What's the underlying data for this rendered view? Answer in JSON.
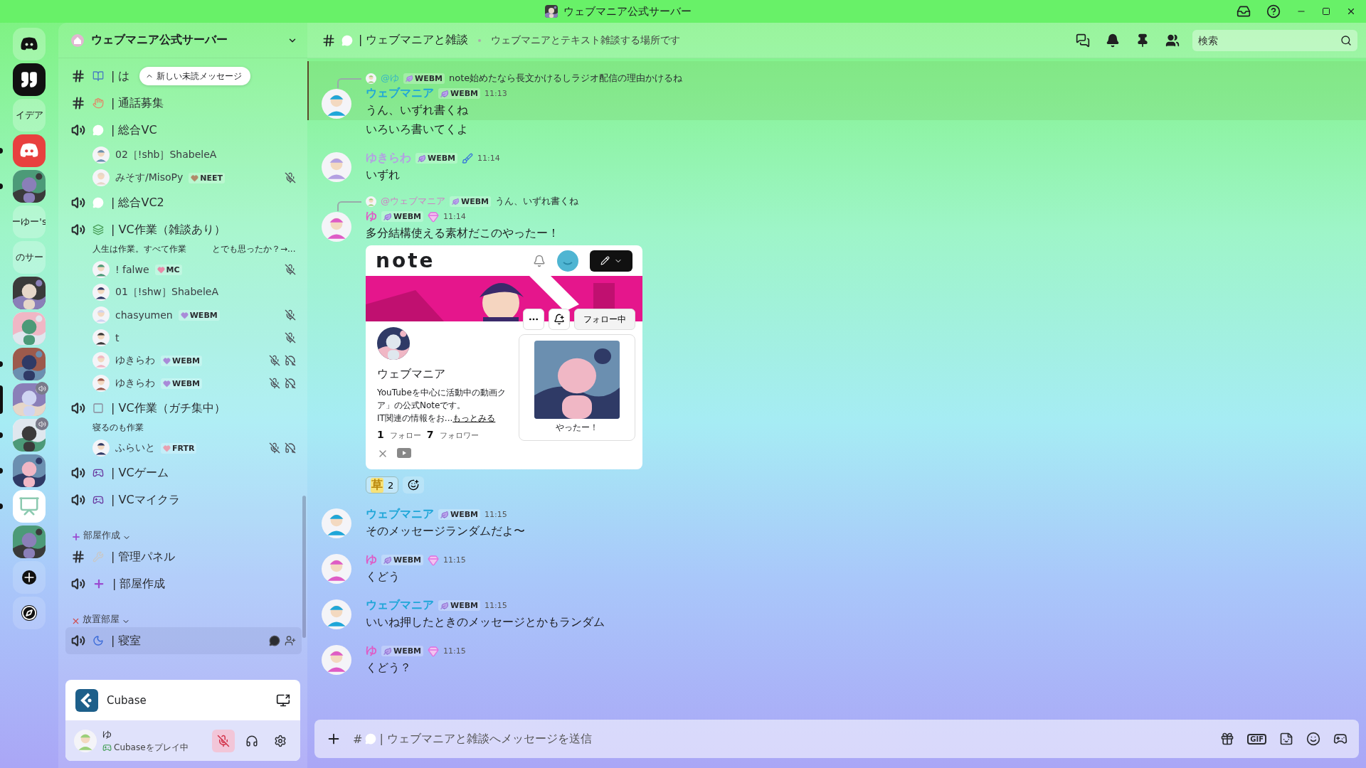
{
  "titlebar": {
    "title": "ウェブマニア公式サーバー"
  },
  "servers": [
    {
      "kind": "home",
      "selected": false,
      "unread": false,
      "voice": false
    },
    {
      "kind": "quote",
      "selected": false,
      "unread": false,
      "voice": false
    },
    {
      "kind": "text",
      "label": "イデア",
      "selected": false,
      "unread": false,
      "voice": false
    },
    {
      "kind": "discord",
      "selected": false,
      "unread": true,
      "voice": false
    },
    {
      "kind": "picture",
      "selected": false,
      "unread": true,
      "voice": false
    },
    {
      "kind": "text",
      "label": "ーゆー's",
      "selected": false,
      "unread": false,
      "voice": false
    },
    {
      "kind": "text",
      "label": "のサー",
      "selected": false,
      "unread": false,
      "voice": false
    },
    {
      "kind": "picture",
      "selected": false,
      "unread": false,
      "voice": false
    },
    {
      "kind": "picture",
      "selected": false,
      "unread": false,
      "voice": false
    },
    {
      "kind": "picture",
      "selected": false,
      "unread": true,
      "voice": false
    },
    {
      "kind": "picture",
      "selected": true,
      "unread": false,
      "voice": true
    },
    {
      "kind": "picture",
      "selected": false,
      "unread": true,
      "voice": true
    },
    {
      "kind": "picture",
      "selected": false,
      "unread": true,
      "voice": false
    },
    {
      "kind": "easel",
      "selected": false,
      "unread": true,
      "voice": false
    },
    {
      "kind": "picture",
      "selected": false,
      "unread": false,
      "voice": false
    },
    {
      "kind": "add",
      "selected": false,
      "unread": false,
      "voice": false
    },
    {
      "kind": "explore",
      "selected": false,
      "unread": false,
      "voice": false
    }
  ],
  "server_header": {
    "name": "ウェブマニア公式サーバー"
  },
  "channels": [
    {
      "kind": "text",
      "name": "| は",
      "selected": false,
      "pill": "新しい未読メッセージ"
    },
    {
      "kind": "text",
      "name": "| 通話募集",
      "selected": false
    },
    {
      "kind": "voice",
      "name": "| 総合VC",
      "selected": false,
      "members": [
        {
          "name": "02［!shb］ShabeleA",
          "muted": false,
          "deafened": false
        },
        {
          "name": "みそす/MisoPy",
          "tag": {
            "label": "NEET",
            "color": "#b08a6a"
          },
          "muted": true,
          "deafened": false
        }
      ]
    },
    {
      "kind": "voice",
      "name": "| 総合VC2",
      "selected": false
    },
    {
      "kind": "voice",
      "name": "| VC作業（雑談あり）",
      "status": "人生は作業。すべて作業　　　とでも思ったか？→...",
      "selected": false,
      "members": [
        {
          "name": "! falwe",
          "tag": {
            "label": "MC",
            "color": "#e88aa8"
          },
          "muted": true,
          "deafened": false
        },
        {
          "name": "01［!shw］ShabeleA",
          "muted": false,
          "deafened": false
        },
        {
          "name": "chasyumen",
          "tag": {
            "label": "WEBM",
            "color": "#a98ad8"
          },
          "muted": true,
          "deafened": false
        },
        {
          "name": "t",
          "muted": true,
          "deafened": false
        },
        {
          "name": "ゆきらわ",
          "tag": {
            "label": "WEBM",
            "color": "#a98ad8"
          },
          "muted": true,
          "deafened": true
        },
        {
          "name": "ゆきらわ",
          "tag": {
            "label": "WEBM",
            "color": "#a98ad8"
          },
          "muted": true,
          "deafened": true
        }
      ]
    },
    {
      "kind": "voice",
      "name": "| VC作業（ガチ集中）",
      "status": "寝るのも作業",
      "selected": false,
      "members": [
        {
          "name": "ふらいと",
          "tag": {
            "label": "FRTR",
            "color": "#e8a0b0"
          },
          "muted": true,
          "deafened": true
        }
      ]
    },
    {
      "kind": "voice",
      "name": "| VCゲーム",
      "selected": false
    },
    {
      "kind": "voice",
      "name": "| VCマイクラ",
      "selected": false
    },
    {
      "kind": "category",
      "name": "部屋作成"
    },
    {
      "kind": "text",
      "name": "| 管理パネル",
      "selected": false
    },
    {
      "kind": "voice",
      "name": "| 部屋作成",
      "selected": false
    },
    {
      "kind": "category",
      "name": "放置部屋"
    },
    {
      "kind": "voice",
      "name": "| 寝室",
      "selected": true
    }
  ],
  "activity": {
    "name": "Cubase"
  },
  "user": {
    "name": "ゆ",
    "status": "Cubaseをプレイ中",
    "muted": true
  },
  "header": {
    "channel": "| ウェブマニアと雑談",
    "topic": "ウェブマニアとテキスト雑談する場所です",
    "search": {
      "placeholder": "検索"
    }
  },
  "messages": [
    {
      "kind": "message",
      "highlighted": true,
      "reply": {
        "author": "@ゆ",
        "tag": "WEBM",
        "text": "note始めたなら長文かけるしラジオ配信の理由かけるね"
      },
      "author": "ウェブマニア",
      "color": "#1fa6d8",
      "tag": "WEBM",
      "gem": false,
      "brush": false,
      "time": "11:13",
      "text": "うん、いずれ書くね"
    },
    {
      "kind": "continuation",
      "highlighted": false,
      "text": "いろいろ書いてくよ"
    },
    {
      "kind": "message",
      "highlighted": false,
      "author": "ゆきらわ",
      "color": "#b3a0e2",
      "tag": "WEBM",
      "gem": false,
      "brush": true,
      "time": "11:14",
      "text": "いずれ"
    },
    {
      "kind": "message",
      "highlighted": false,
      "reply": {
        "author": "@ウェブマニア",
        "tag": "WEBM",
        "text": "うん、いずれ書くね"
      },
      "author": "ゆ",
      "color": "#de5cc6",
      "tag": "WEBM",
      "gem": true,
      "brush": false,
      "time": "11:14",
      "text": "多分結構使える素材だこのやったー！",
      "embed": {
        "logo": "note",
        "follow": "フォロー中",
        "name": "ウェブマニア",
        "bio": "YouTubeを中心に活動中の動画クア」の公式Noteです。\nIT関連の情報をお...",
        "more": "もっとみる",
        "stats": [
          {
            "count": "1",
            "label": "フォロー"
          },
          {
            "count": "7",
            "label": "フォロワー"
          }
        ],
        "popup": "やったー！"
      },
      "reactions": [
        {
          "emoji": "草",
          "count": "2"
        }
      ]
    },
    {
      "kind": "message",
      "highlighted": false,
      "author": "ウェブマニア",
      "color": "#1fa6d8",
      "tag": "WEBM",
      "gem": false,
      "brush": false,
      "time": "11:15",
      "text": "そのメッセージランダムだよ〜"
    },
    {
      "kind": "message",
      "highlighted": false,
      "author": "ゆ",
      "color": "#de5cc6",
      "tag": "WEBM",
      "gem": true,
      "brush": false,
      "time": "11:15",
      "text": "くどう"
    },
    {
      "kind": "message",
      "highlighted": false,
      "author": "ウェブマニア",
      "color": "#1fa6d8",
      "tag": "WEBM",
      "gem": false,
      "brush": false,
      "time": "11:15",
      "text": "いいね押したときのメッセージとかもランダム"
    },
    {
      "kind": "message",
      "highlighted": false,
      "author": "ゆ",
      "color": "#de5cc6",
      "tag": "WEBM",
      "gem": true,
      "brush": false,
      "time": "11:15",
      "text": "くどう？"
    }
  ],
  "composer": {
    "prefix": "#",
    "placeholder": "| ウェブマニアと雑談へメッセージを送信",
    "gif": "GIF"
  }
}
